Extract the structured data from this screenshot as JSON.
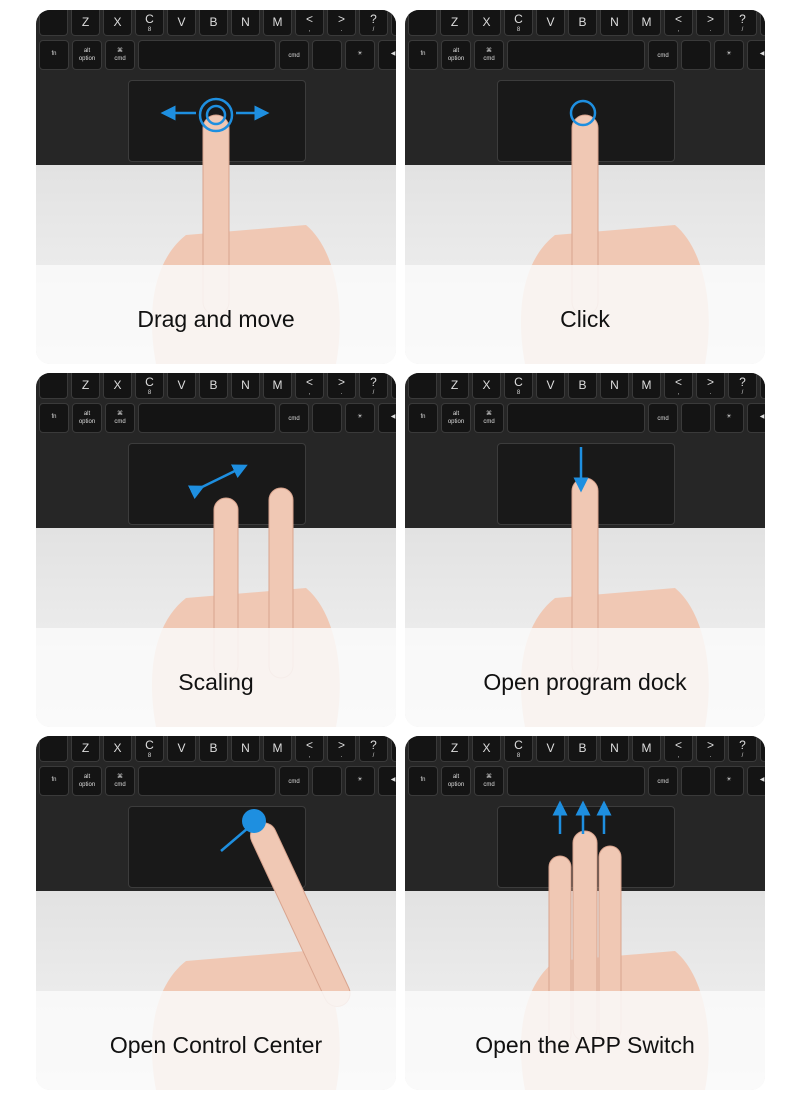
{
  "keyboard": {
    "row1": [
      "",
      "Z",
      "X",
      "C",
      "V",
      "B",
      "N",
      "M",
      "<",
      ">",
      "?",
      ""
    ],
    "row1_sub": [
      "",
      "",
      "",
      "8",
      "",
      "",
      "",
      "",
      ",",
      ".",
      "/",
      ""
    ],
    "row2": [
      "fn",
      "alt",
      "⌘",
      "",
      "",
      "",
      "☀",
      "◀",
      "▲▼"
    ],
    "row2_sub": [
      "",
      "option",
      "cmd",
      "",
      "cmd",
      "",
      "",
      "",
      ""
    ]
  },
  "accent_color": "#1e8fe0",
  "panels": [
    {
      "label": "Drag and move",
      "gesture": "drag"
    },
    {
      "label": "Click",
      "gesture": "click"
    },
    {
      "label": "Scaling",
      "gesture": "pinch"
    },
    {
      "label": "Open program dock",
      "gesture": "swipe-down"
    },
    {
      "label": "Open Control Center",
      "gesture": "corner"
    },
    {
      "label": "Open the APP Switch",
      "gesture": "three-finger-up"
    }
  ]
}
